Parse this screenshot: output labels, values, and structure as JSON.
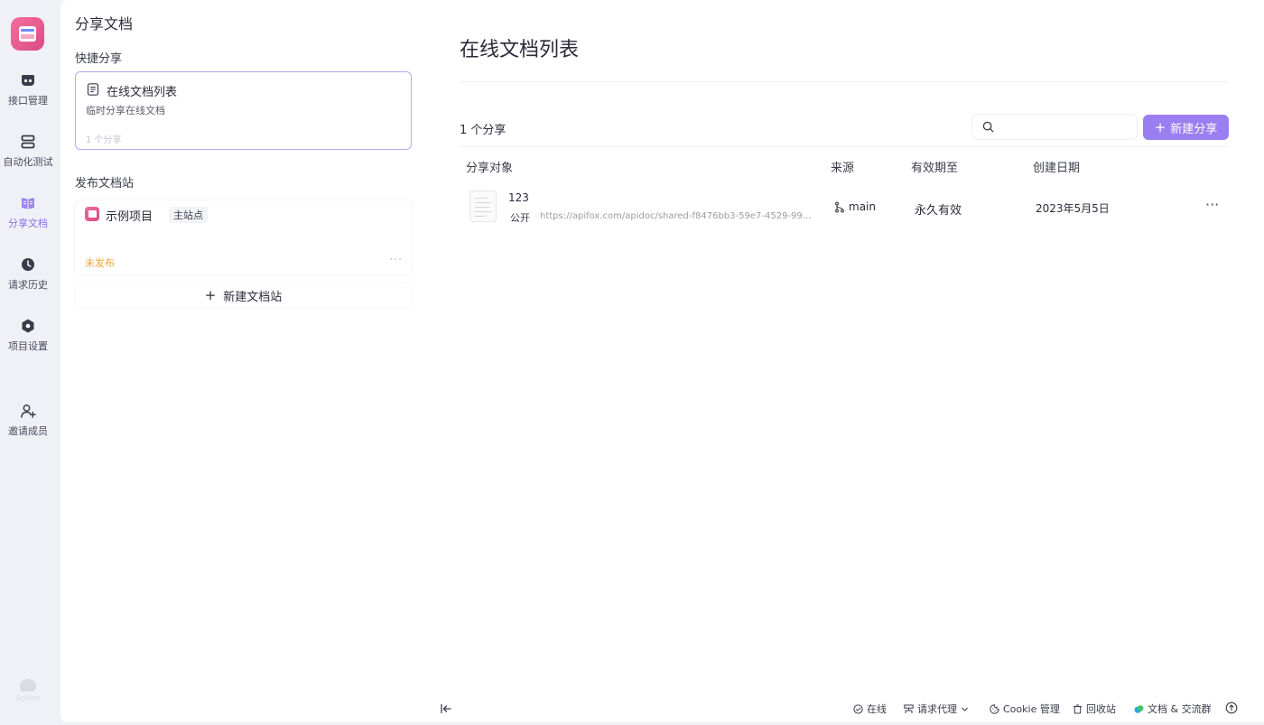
{
  "rail": {
    "items": [
      {
        "label": "接口管理",
        "icon": "api-icon"
      },
      {
        "label": "自动化测试",
        "icon": "automation-icon"
      },
      {
        "label": "分享文档",
        "icon": "book-icon"
      },
      {
        "label": "请求历史",
        "icon": "clock-icon"
      },
      {
        "label": "项目设置",
        "icon": "settings-hex-icon"
      },
      {
        "label": "邀请成员",
        "icon": "add-user-icon"
      }
    ],
    "brand": "Apifox"
  },
  "sidebar": {
    "title": "分享文档",
    "quick_share": {
      "section_title": "快捷分享",
      "card_name": "在线文档列表",
      "card_desc": "临时分享在线文档",
      "card_count": "1 个分享"
    },
    "doc_site": {
      "section_title": "发布文档站",
      "site_name": "示例项目",
      "site_badge": "主站点",
      "site_status": "未发布",
      "more": "···",
      "new_site_label": "新建文档站"
    }
  },
  "main": {
    "title": "在线文档列表",
    "share_count": "1 个分享",
    "search": {
      "placeholder": ""
    },
    "new_share_label": "新建分享",
    "table": {
      "headers": [
        "分享对象",
        "来源",
        "有效期至",
        "创建日期"
      ],
      "rows": [
        {
          "name": "123",
          "visibility": "公开",
          "url": "https://apifox.com/apidoc/shared-f8476bb3-59e7-4529-993d-...",
          "branch": "main",
          "expire": "永久有效",
          "created": "2023年5月5日",
          "more": "···"
        }
      ]
    }
  },
  "statusbar": {
    "online": "在线",
    "proxy": "请求代理",
    "cookie": "Cookie 管理",
    "recycle": "回收站",
    "docs": "文档 & 交流群"
  },
  "colors": {
    "accent": "#9b7ff0",
    "warning": "#f0a33a",
    "logo": "#e85c8e"
  }
}
